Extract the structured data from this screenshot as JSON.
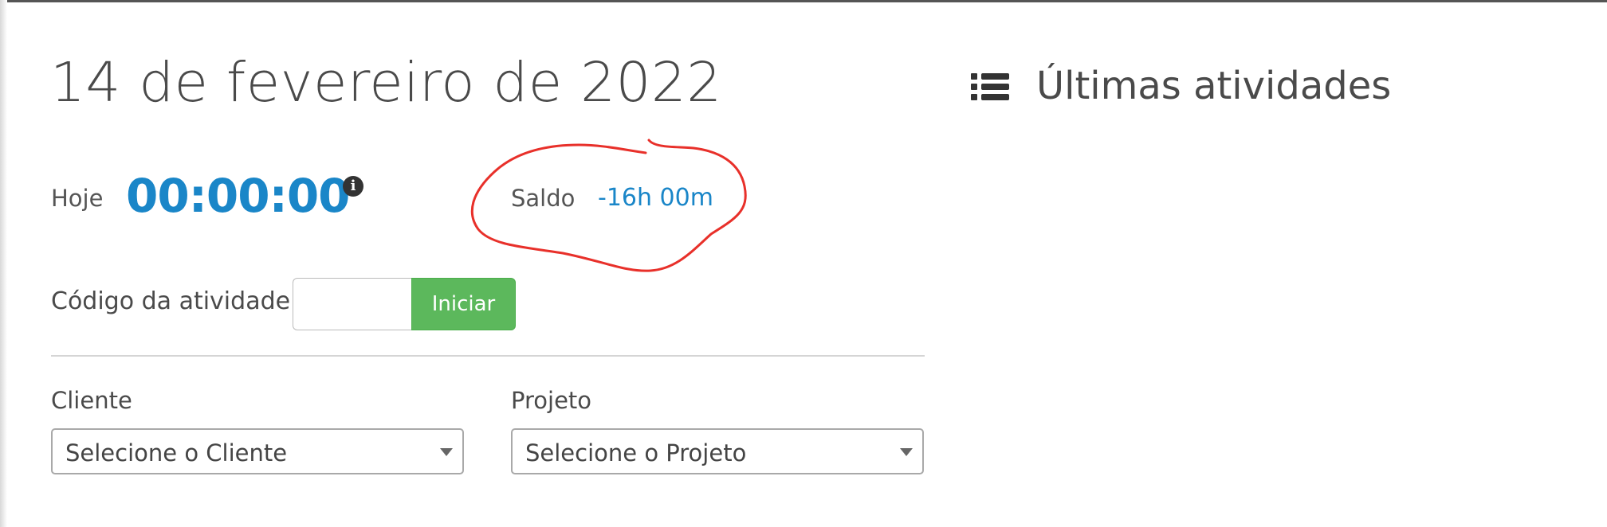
{
  "header": {
    "date_title": "14 de fevereiro de 2022"
  },
  "timer": {
    "today_label": "Hoje",
    "today_value": "00:00:00",
    "info_icon": "info-circle-icon",
    "balance_label": "Saldo",
    "balance_value": "-16h 00m"
  },
  "activity": {
    "code_label": "Código da atividade",
    "code_value": "",
    "start_button_label": "Iniciar"
  },
  "filters": {
    "client_label": "Cliente",
    "client_selected": "Selecione o Cliente",
    "project_label": "Projeto",
    "project_selected": "Selecione o Projeto"
  },
  "recent": {
    "icon": "list-icon",
    "title": "Últimas atividades"
  },
  "colors": {
    "accent_blue": "#1a86c8",
    "success_green": "#5cb85c",
    "annotation_red": "#e8302a"
  }
}
